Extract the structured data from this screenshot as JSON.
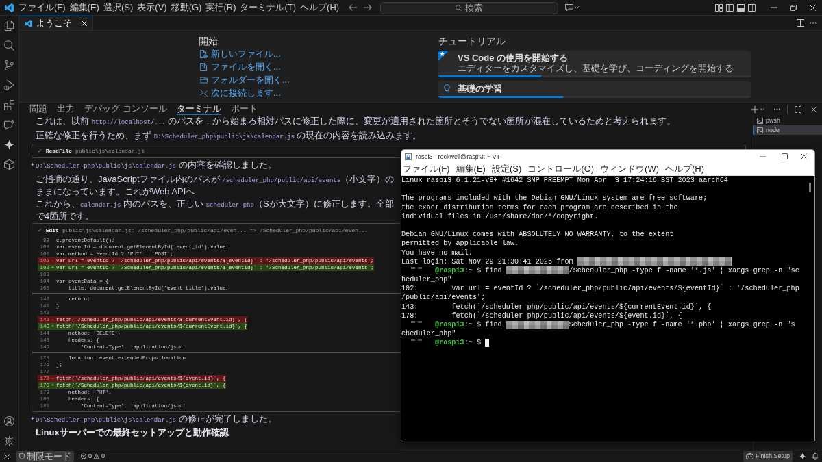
{
  "title_bar": {
    "menu": [
      "ファイル(F)",
      "編集(E)",
      "選択(S)",
      "表示(V)",
      "移動(G)",
      "実行(R)",
      "ターミナル(T)",
      "ヘルプ(H)"
    ],
    "search": {
      "placeholder": "検索"
    }
  },
  "editor_tabs": [
    {
      "label": "ようこそ",
      "selected": true
    }
  ],
  "welcome": {
    "start": {
      "heading": "開始",
      "links": [
        "新しいファイル...",
        "ファイルを開く...",
        "フォルダーを開く...",
        "次に接続します..."
      ]
    },
    "walkthroughs": {
      "heading": "チュートリアル",
      "cards": [
        {
          "kind": "featured",
          "title": "VS Code の使用を開始する",
          "description": "エディターをカスタマイズし、基礎を学び、コーディングを開始する",
          "level": 0.33
        },
        {
          "kind": "topic",
          "title": "基礎の学習",
          "level": 0.4
        }
      ]
    }
  },
  "panel": {
    "tabs": [
      {
        "label": "問題",
        "selected": false
      },
      {
        "label": "出力",
        "selected": false
      },
      {
        "label": "デバッグ コンソール",
        "selected": false
      },
      {
        "label": "ターミナル",
        "selected": true
      },
      {
        "label": "ポート",
        "selected": false
      }
    ],
    "terminals": [
      {
        "label": "pwsh",
        "selected": false
      },
      {
        "label": "node",
        "selected": true
      }
    ],
    "content": [
      {
        "kind": "text",
        "parts": [
          {
            "kind": "plain",
            "text": "これは、以前 "
          },
          {
            "kind": "code",
            "text": "http://localhost/..."
          },
          {
            "kind": "plain",
            "text": " のパスを "
          },
          {
            "kind": "code",
            "text": "."
          },
          {
            "kind": "plain",
            "text": " から始まる相対パスに修正した際に、変更が適用された箇所とそうでない箇所が混在しているためと考えられます。"
          }
        ]
      },
      {
        "kind": "text",
        "parts": [
          {
            "kind": "plain",
            "text": "正確な修正を行うため、まず "
          },
          {
            "kind": "code",
            "text": "D:\\Scheduler_php\\public\\js\\calendar.js"
          },
          {
            "kind": "plain",
            "text": " の現在の内容を読み込みます。"
          }
        ]
      },
      {
        "kind": "tool",
        "mark": "✓",
        "name": "ReadFile",
        "detail": "public\\js\\calendar.js"
      },
      {
        "kind": "reply",
        "mark": "✦",
        "parts": [
          {
            "kind": "code",
            "text": "D:\\Scheduler_php\\public\\js\\calendar.js"
          },
          {
            "kind": "plain",
            "text": " の内容を確認しました。"
          }
        ]
      },
      {
        "kind": "text",
        "parts": [
          {
            "kind": "plain",
            "text": "ご指摘の通り、JavaScriptファイル内のパスが "
          },
          {
            "kind": "code",
            "text": "/scheduler_php/public/api/events"
          },
          {
            "kind": "plain",
            "text": "（小文字）のままになっています。これがWeb APIへ"
          }
        ]
      },
      {
        "kind": "text",
        "parts": [
          {
            "kind": "plain",
            "text": "これから、"
          },
          {
            "kind": "code",
            "text": "calendar.js"
          },
          {
            "kind": "plain",
            "text": " 内のパスを、正しい "
          },
          {
            "kind": "code",
            "text": "Scheduler_php"
          },
          {
            "kind": "plain",
            "text": "（Sが大文字）に修正します。全部で4箇所です。"
          }
        ]
      },
      {
        "kind": "tool",
        "mark": "✓",
        "name": "Edit",
        "detail": "public\\js\\calendar.js: /scheduler_php/public/api/even... => /Scheduler_php/public/api/even...",
        "diff": [
          {
            "kind": "context",
            "num": "99",
            "code": "e.preventDefault();"
          },
          {
            "kind": "context",
            "num": "100",
            "code": "var eventId = document.getElementById('event_id').value;"
          },
          {
            "kind": "context",
            "num": "101",
            "code": "var method = eventId ? 'PUT' : 'POST';"
          },
          {
            "kind": "removed",
            "num": "102",
            "sign": "-",
            "code": "var url = eventId ? `/scheduler_php/public/api/events/${eventId}` : '/scheduler_php/public/api/events';"
          },
          {
            "kind": "added",
            "num": "102",
            "sign": "+",
            "code": "var url = eventId ? `/Scheduler_php/public/api/events/${eventId}` : '/Scheduler_php/public/api/events';"
          },
          {
            "kind": "context",
            "num": "103"
          },
          {
            "kind": "context",
            "num": "104",
            "code": "var eventData = {"
          },
          {
            "kind": "context",
            "num": "105",
            "code": "    title: document.getElementById('event_title').value,"
          },
          {
            "kind": "separator"
          },
          {
            "kind": "context",
            "num": "140",
            "code": "    return;"
          },
          {
            "kind": "context",
            "num": "141",
            "code": "}"
          },
          {
            "kind": "context",
            "num": "142"
          },
          {
            "kind": "removed",
            "num": "143",
            "sign": "-",
            "code": "fetch(`/scheduler_php/public/api/events/${currentEvent.id}`, {"
          },
          {
            "kind": "added",
            "num": "143",
            "sign": "+",
            "code": "fetch(`/Scheduler_php/public/api/events/${currentEvent.id}`, {"
          },
          {
            "kind": "context",
            "num": "144",
            "code": "    method: 'DELETE',"
          },
          {
            "kind": "context",
            "num": "145",
            "code": "    headers: {"
          },
          {
            "kind": "context",
            "num": "146",
            "code": "        'Content-Type': 'application/json'"
          },
          {
            "kind": "separator"
          },
          {
            "kind": "context",
            "num": "175",
            "code": "    location: event.extendedProps.location"
          },
          {
            "kind": "context",
            "num": "176",
            "code": "};"
          },
          {
            "kind": "context",
            "num": "177"
          },
          {
            "kind": "removed",
            "num": "178",
            "sign": "-",
            "code": "fetch(`/scheduler_php/public/api/events/${event.id}`, {"
          },
          {
            "kind": "added",
            "num": "178",
            "sign": "+",
            "code": "fetch(`/Scheduler_php/public/api/events/${event.id}`, {"
          },
          {
            "kind": "context",
            "num": "179",
            "code": "    method: 'PUT',"
          },
          {
            "kind": "context",
            "num": "180",
            "code": "    headers: {"
          },
          {
            "kind": "context",
            "num": "181",
            "code": "        'Content-Type': 'application/json'"
          }
        ]
      },
      {
        "kind": "reply",
        "mark": "✦",
        "parts": [
          {
            "kind": "code",
            "text": "D:\\Scheduler_php\\public\\js\\calendar.js"
          },
          {
            "kind": "plain",
            "text": " の修正が完了しました。"
          }
        ]
      },
      {
        "kind": "heading",
        "parts": [
          {
            "kind": "plain",
            "text": "Linuxサーバーでの最終セットアップと動作確認"
          }
        ]
      }
    ]
  },
  "vt_window": {
    "title": "raspi3 - rockwell@raspi3: ~ VT",
    "menu": [
      "ファイル(F)",
      "編集(E)",
      "設定(S)",
      "コントロール(O)",
      "ウィンドウ(W)",
      "ヘルプ(H)"
    ],
    "lines": [
      {
        "kind": "plain",
        "text": "Linux raspi3 6.1.21-v8+ #1642 SMP PREEMPT Mon Apr  3 17:24:16 BST 2023 aarch64"
      },
      {
        "kind": "blank"
      },
      {
        "kind": "plain",
        "text": "The programs included with the Debian GNU/Linux system are free software;"
      },
      {
        "kind": "plain",
        "text": "the exact distribution terms for each program are described in the"
      },
      {
        "kind": "plain",
        "text": "individual files in /usr/share/doc/*/copyright."
      },
      {
        "kind": "blank"
      },
      {
        "kind": "plain",
        "text": "Debian GNU/Linux comes with ABSOLUTELY NO WARRANTY, to the extent"
      },
      {
        "kind": "plain",
        "text": "permitted by applicable law."
      },
      {
        "kind": "plain",
        "text": "You have no mail."
      },
      {
        "kind": "segments",
        "segments": [
          {
            "kind": "text",
            "text": "Last login: Sat Nov 29 21:30:41 2025 from "
          },
          {
            "kind": "redacted_host"
          }
        ]
      },
      {
        "kind": "segments",
        "segments": [
          {
            "kind": "redacted_user"
          },
          {
            "kind": "prompt",
            "text": "@raspi3"
          },
          {
            "kind": "text",
            "text": ":~ $ find "
          },
          {
            "kind": "redacted_path"
          },
          {
            "kind": "text",
            "text": "/Scheduler_php -type f -name '*.js' ¦ xargs grep -n \"sc"
          }
        ]
      },
      {
        "kind": "plain",
        "text": "heduler_php\""
      },
      {
        "kind": "plain",
        "text": "102:        var url = eventId ? `/scheduler_php/public/api/events/${eventId}` : '/scheduler_php"
      },
      {
        "kind": "plain",
        "text": "/public/api/events';"
      },
      {
        "kind": "plain",
        "text": "143:        fetch(`/scheduler_php/public/api/events/${currentEvent.id}`, {"
      },
      {
        "kind": "plain",
        "text": "178:        fetch(`/scheduler_php/public/api/events/${event.id}`, {"
      },
      {
        "kind": "segments",
        "segments": [
          {
            "kind": "redacted_user"
          },
          {
            "kind": "prompt",
            "text": "@raspi3"
          },
          {
            "kind": "text",
            "text": ":~ $ find "
          },
          {
            "kind": "redacted_path"
          },
          {
            "kind": "text",
            "text": "Scheduler_php -type f -name '*.php' ¦ xargs grep -n \"s"
          }
        ]
      },
      {
        "kind": "plain",
        "text": "cheduler_php\""
      },
      {
        "kind": "segments",
        "segments": [
          {
            "kind": "redacted_user"
          },
          {
            "kind": "prompt",
            "text": "@raspi3"
          },
          {
            "kind": "text",
            "text": ":~ $"
          },
          {
            "kind": "cursor"
          }
        ]
      }
    ]
  },
  "status_bar": {
    "mode": "制限モード",
    "errors": "0",
    "warnings": "0",
    "setup": "Finish Setup"
  }
}
